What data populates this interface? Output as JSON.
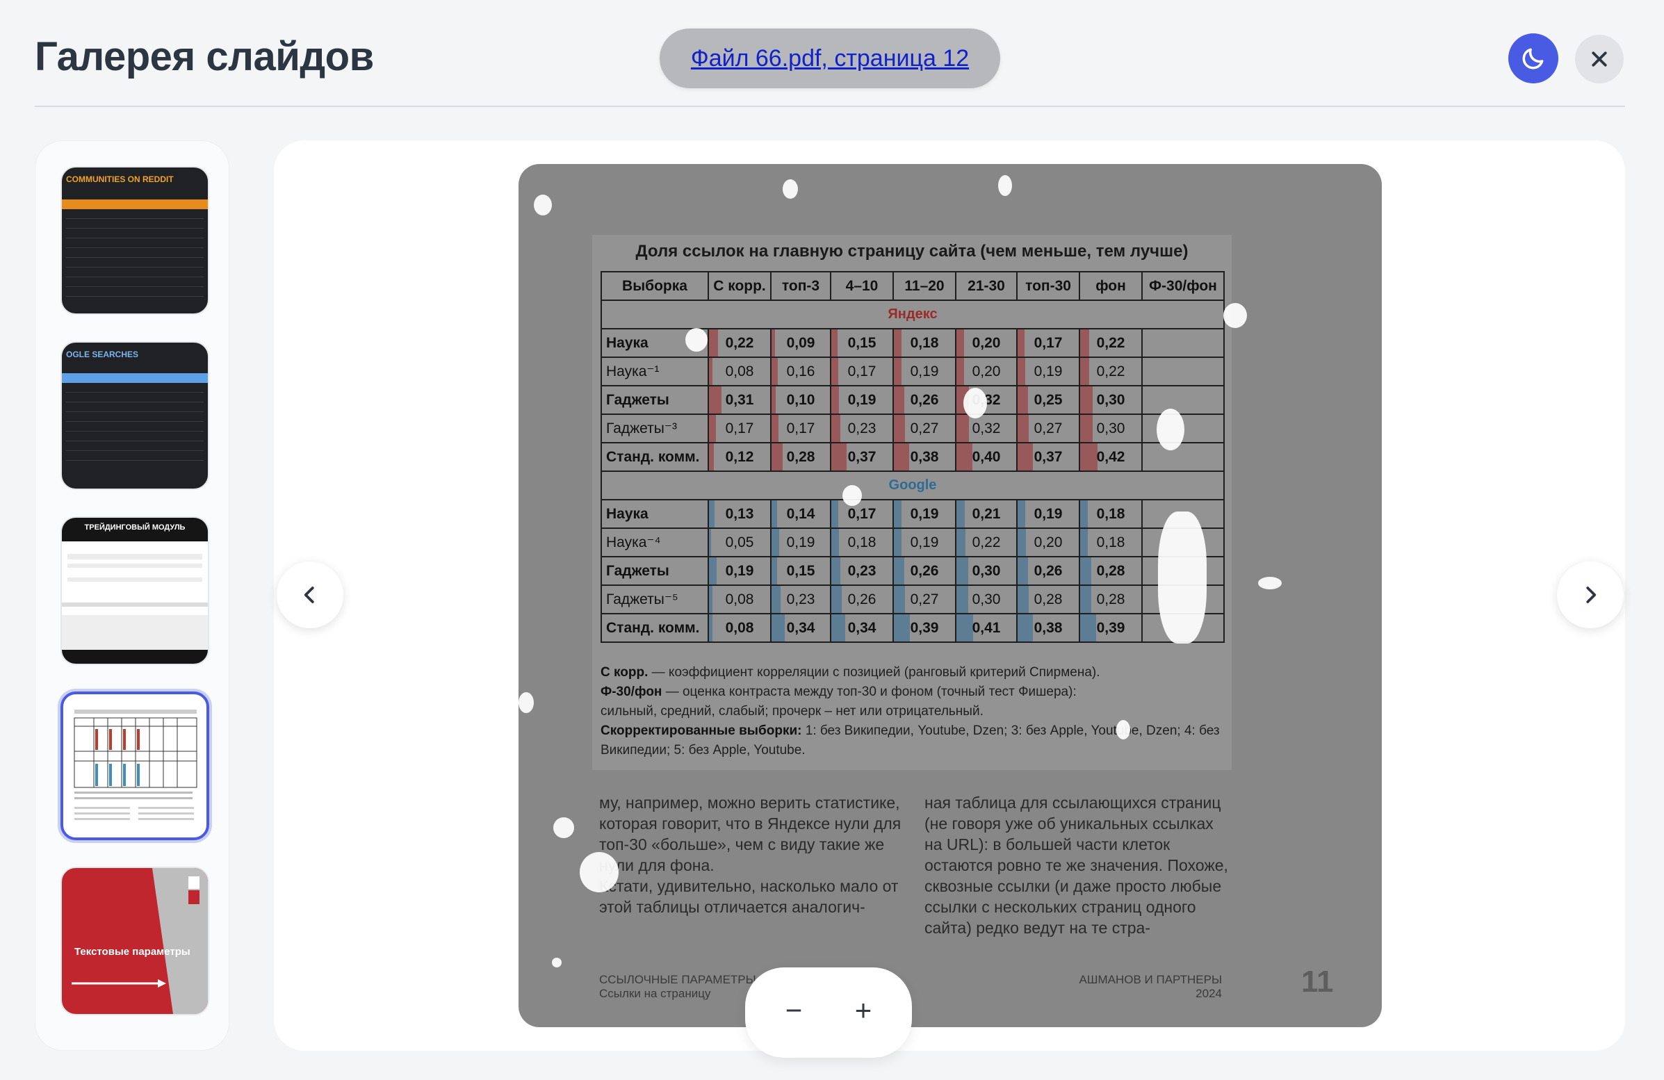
{
  "header": {
    "title": "Галерея слайдов",
    "file_link": "Файл 66.pdf, страница 12"
  },
  "icons": {
    "theme": "moon-icon",
    "close": "close-icon",
    "prev": "chevron-left-icon",
    "next": "chevron-right-icon"
  },
  "colors": {
    "accent": "#4a5be3",
    "yandex_red": "#9b2a2a",
    "google_blue": "#2f6c94"
  },
  "thumbnails": [
    {
      "caption": "COMMUNITIES ON REDDIT"
    },
    {
      "caption": "OGLE SEARCHES"
    },
    {
      "caption": "ТРЕЙДИНГОВЫЙ МОДУЛЬ"
    },
    {
      "caption": "",
      "selected": true
    },
    {
      "caption": "Текстовые параметры"
    }
  ],
  "slide": {
    "table_title": "Доля ссылок на главную страницу сайта (чем меньше, тем лучше)",
    "columns": [
      "Выборка",
      "С корр.",
      "топ-3",
      "4–10",
      "11–20",
      "21-30",
      "топ-30",
      "фон",
      "Ф-30/фон"
    ],
    "sections": [
      {
        "name": "Яндекс",
        "rows": [
          {
            "label": "Наука",
            "values": [
              "0,22",
              "0,09",
              "0,15",
              "0,18",
              "0,20",
              "0,17",
              "0,22"
            ],
            "bold": true
          },
          {
            "label": "Наука⁻¹",
            "values": [
              "0,08",
              "0,16",
              "0,17",
              "0,19",
              "0,20",
              "0,19",
              "0,22"
            ],
            "bold": false
          },
          {
            "label": "Гаджеты",
            "values": [
              "0,31",
              "0,10",
              "0,19",
              "0,26",
              "0,32",
              "0,25",
              "0,30"
            ],
            "bold": true
          },
          {
            "label": "Гаджеты⁻³",
            "values": [
              "0,17",
              "0,17",
              "0,23",
              "0,27",
              "0,32",
              "0,27",
              "0,30"
            ],
            "bold": false
          },
          {
            "label": "Станд. комм.",
            "values": [
              "0,12",
              "0,28",
              "0,37",
              "0,38",
              "0,40",
              "0,37",
              "0,42"
            ],
            "bold": true
          }
        ]
      },
      {
        "name": "Google",
        "rows": [
          {
            "label": "Наука",
            "values": [
              "0,13",
              "0,14",
              "0,17",
              "0,19",
              "0,21",
              "0,19",
              "0,18"
            ],
            "bold": true
          },
          {
            "label": "Наука⁻⁴",
            "values": [
              "0,05",
              "0,19",
              "0,18",
              "0,19",
              "0,22",
              "0,20",
              "0,18"
            ],
            "bold": false
          },
          {
            "label": "Гаджеты",
            "values": [
              "0,19",
              "0,15",
              "0,23",
              "0,26",
              "0,30",
              "0,26",
              "0,28"
            ],
            "bold": true
          },
          {
            "label": "Гаджеты⁻⁵",
            "values": [
              "0,08",
              "0,23",
              "0,26",
              "0,27",
              "0,30",
              "0,28",
              "0,28"
            ],
            "bold": false
          },
          {
            "label": "Станд. комм.",
            "values": [
              "0,08",
              "0,34",
              "0,34",
              "0,39",
              "0,41",
              "0,38",
              "0,39"
            ],
            "bold": true
          }
        ]
      }
    ],
    "note1_term": "С корр.",
    "note1_text": " — коэффициент корреляции с позицией (ранговый критерий Спирмена).",
    "note2_term": "Ф-30/фон",
    "note2_text": " — оценка контраста между топ-30 и фоном (точный тест Фишера):",
    "note2_legend": "сильный, средний, слабый; прочерк – нет или отрицательный.",
    "note3_term": "Скорректированные выборки:",
    "note3_text": " 1: без Википедии, Youtube, Dzen; 3: без Apple, Youtube, Dzen; 4: без Википедии; 5: без Apple, Youtube.",
    "body_left": "му, например, можно верить статистике, которая говорит, что в Яндексе нули для топ-30 «больше», чем с виду такие же нули для фона.\nКстати, удивительно, насколько мало от этой таблицы отличается аналогич-",
    "body_right": "ная таблица для ссылающихся страниц (не говоря уже об уникальных ссылках на URL): в большей части клеток остаются ровно те же значения. Похоже, сквозные ссылки (и даже просто любые ссылки с нескольких страниц одного сайта) редко ведут на те стра-",
    "footer_left_1": "ССЫЛОЧНЫЕ ПАРАМЕТРЫ",
    "footer_left_2": "Ссылки на страницу",
    "footer_right_1": "АШМАНОВ И ПАРТНЕРЫ",
    "footer_right_2": "2024",
    "page_number": "11"
  },
  "zoom": {
    "out_label": "−",
    "in_label": "+"
  }
}
